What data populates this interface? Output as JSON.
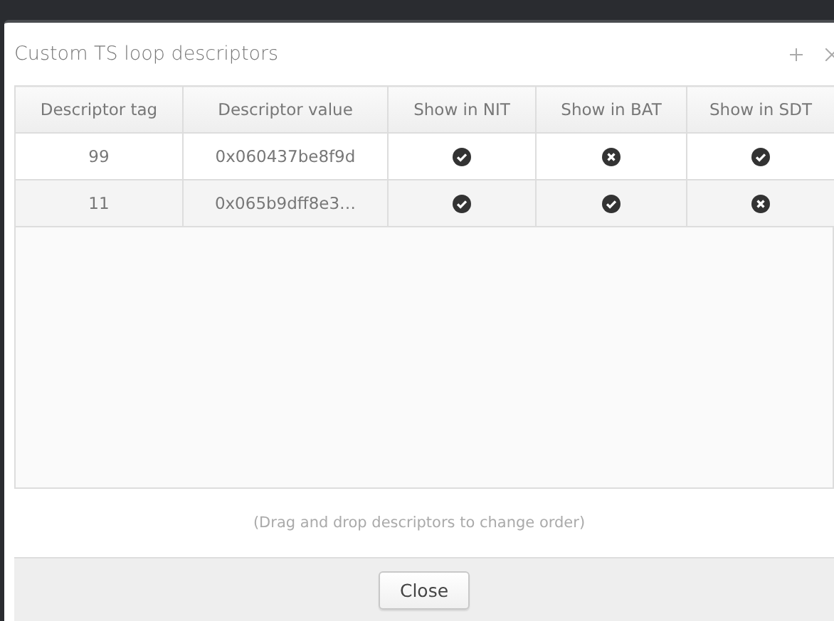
{
  "dialog": {
    "title": "Custom TS loop descriptors"
  },
  "table": {
    "columns": [
      "Descriptor tag",
      "Descriptor value",
      "Show in NIT",
      "Show in BAT",
      "Show in SDT"
    ],
    "rows": [
      {
        "tag": "99",
        "value": "0x060437be8f9d",
        "nit": true,
        "bat": false,
        "sdt": true
      },
      {
        "tag": "11",
        "value": "0x065b9dff8e3…",
        "nit": true,
        "bat": true,
        "sdt": false
      }
    ]
  },
  "hint": "(Drag and drop descriptors to change order)",
  "buttons": [
    "Close"
  ]
}
